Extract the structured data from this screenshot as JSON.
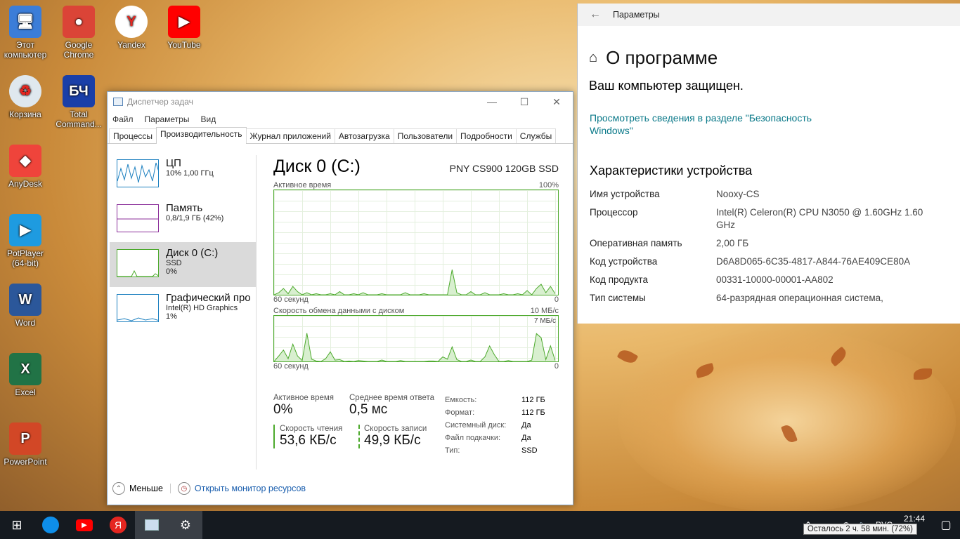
{
  "desktop": {
    "icons": [
      {
        "label": "Этот компьютер",
        "glyph": "🖥",
        "color": "#3b7dd8"
      },
      {
        "label": "Google Chrome",
        "glyph": "●",
        "color": "#db4437"
      },
      {
        "label": "Yandex",
        "glyph": "Y",
        "color": "#ffffff"
      },
      {
        "label": "YouTube",
        "glyph": "▶",
        "color": "#ff0000"
      },
      {
        "label": "Корзина",
        "glyph": "♻",
        "color": "#dfe8ee"
      },
      {
        "label": "Total Command...",
        "glyph": "БЧ",
        "color": "#1a3fa8"
      },
      {
        "label": "AnyDesk",
        "glyph": "◆",
        "color": "#ef443b"
      },
      {
        "label": "PotPlayer (64-bit)",
        "glyph": "▶",
        "color": "#1e9be0"
      },
      {
        "label": "Word",
        "glyph": "W",
        "color": "#2b579a"
      },
      {
        "label": "Excel",
        "glyph": "X",
        "color": "#217346"
      },
      {
        "label": "PowerPoint",
        "glyph": "P",
        "color": "#d24726"
      }
    ]
  },
  "taskmgr": {
    "title": "Диспетчер задач",
    "menu": [
      "Файл",
      "Параметры",
      "Вид"
    ],
    "tabs": [
      "Процессы",
      "Производительность",
      "Журнал приложений",
      "Автозагрузка",
      "Пользователи",
      "Подробности",
      "Службы"
    ],
    "side": [
      {
        "name": "ЦП",
        "s1": "10% 1,00 ГГц",
        "s2": "",
        "color": "#1b7fbf"
      },
      {
        "name": "Память",
        "s1": "0,8/1,9 ГБ (42%)",
        "s2": "",
        "color": "#8b2f9a"
      },
      {
        "name": "Диск 0 (C:)",
        "s1": "SSD",
        "s2": "0%",
        "color": "#4ca92c"
      },
      {
        "name": "Графический про",
        "s1": "Intel(R) HD Graphics",
        "s2": "1%",
        "color": "#1b7fbf"
      }
    ],
    "main": {
      "title": "Диск 0 (C:)",
      "model": "PNY CS900 120GB SSD",
      "g1_label": "Активное время",
      "g1_max": "100%",
      "g1_xleft": "60 секунд",
      "g1_xright": "0",
      "g2_label": "Скорость обмена данными с диском",
      "g2_max": "10 МБ/с",
      "g2_mark": "7 МБ/с",
      "g2_xleft": "60 секунд",
      "g2_xright": "0",
      "active_label": "Активное время",
      "active_val": "0%",
      "resp_label": "Среднее время ответа",
      "resp_val": "0,5 мс",
      "read_label": "Скорость чтения",
      "read_val": "53,6 КБ/с",
      "write_label": "Скорость записи",
      "write_val": "49,9 КБ/с",
      "props": [
        [
          "Емкость:",
          "112 ГБ"
        ],
        [
          "Формат:",
          "112 ГБ"
        ],
        [
          "Системный диск:",
          "Да"
        ],
        [
          "Файл подкачки:",
          "Да"
        ],
        [
          "Тип:",
          "SSD"
        ]
      ]
    },
    "footer": {
      "less": "Меньше",
      "monitor": "Открыть монитор ресурсов"
    }
  },
  "chart_data": [
    {
      "type": "area",
      "title": "Активное время",
      "ylim": [
        0,
        100
      ],
      "x": [
        0,
        1,
        2,
        3,
        4,
        5,
        6,
        7,
        8,
        9,
        10,
        11,
        12,
        13,
        14,
        15,
        16,
        17,
        18,
        19,
        20,
        21,
        22,
        23,
        24,
        25,
        26,
        27,
        28,
        29,
        30,
        31,
        32,
        33,
        34,
        35,
        36,
        37,
        38,
        39,
        40,
        41,
        42,
        43,
        44,
        45,
        46,
        47,
        48,
        49,
        50,
        51,
        52,
        53,
        54,
        55,
        56,
        57,
        58,
        59,
        60
      ],
      "values": [
        0,
        2,
        6,
        1,
        8,
        3,
        0,
        2,
        0,
        1,
        0,
        0,
        1,
        0,
        3,
        0,
        0,
        1,
        0,
        2,
        0,
        0,
        0,
        1,
        0,
        0,
        0,
        0,
        2,
        0,
        0,
        0,
        1,
        0,
        0,
        0,
        0,
        0,
        24,
        2,
        0,
        0,
        3,
        0,
        0,
        2,
        0,
        0,
        0,
        1,
        0,
        0,
        1,
        0,
        4,
        0,
        6,
        10,
        2,
        8,
        1
      ]
    },
    {
      "type": "area",
      "title": "Скорость обмена данными с диском",
      "ylim": [
        0,
        10
      ],
      "x": [
        0,
        1,
        2,
        3,
        4,
        5,
        6,
        7,
        8,
        9,
        10,
        11,
        12,
        13,
        14,
        15,
        16,
        17,
        18,
        19,
        20,
        21,
        22,
        23,
        24,
        25,
        26,
        27,
        28,
        29,
        30,
        31,
        32,
        33,
        34,
        35,
        36,
        37,
        38,
        39,
        40,
        41,
        42,
        43,
        44,
        45,
        46,
        47,
        48,
        49,
        50,
        51,
        52,
        53,
        54,
        55,
        56,
        57,
        58,
        59,
        60
      ],
      "values": [
        0,
        1.2,
        2.5,
        0.6,
        3.8,
        1.2,
        0.2,
        6.2,
        0.5,
        0.1,
        0,
        0.6,
        2.1,
        0.3,
        0.4,
        0,
        0.1,
        0,
        0.2,
        0.1,
        0,
        0,
        0,
        0.3,
        0,
        0,
        0,
        0.2,
        0,
        0,
        0,
        0,
        0,
        0.1,
        0.1,
        0,
        1,
        0.5,
        3.2,
        0.4,
        0,
        0,
        0.3,
        0,
        0,
        1,
        3.4,
        1.5,
        0,
        0,
        0.2,
        0,
        0,
        0,
        0,
        0.3,
        6.1,
        5.2,
        0.4,
        3.4,
        0.2
      ]
    }
  ],
  "settings": {
    "topbar": "Параметры",
    "title": "О программе",
    "protected": "Ваш компьютер защищен.",
    "link": "Просмотреть сведения в разделе \"Безопасность Windows\"",
    "specs_title": "Характеристики устройства",
    "rows": [
      [
        "Имя устройства",
        "Nooxy-CS"
      ],
      [
        "Процессор",
        "Intel(R) Celeron(R) CPU  N3050  @ 1.60GHz 1.60 GHz"
      ],
      [
        "Оперативная память",
        "2,00 ГБ"
      ],
      [
        "Код устройства",
        "D6A8D065-6C35-4817-A844-76AE409CE80A"
      ],
      [
        "Код продукта",
        "00331-10000-00001-AA802"
      ],
      [
        "Тип системы",
        "64-разрядная операционная система,"
      ]
    ]
  },
  "taskbar": {
    "lang": "РУС",
    "time": "21:44",
    "tooltip": "Осталось 2 ч. 58 мин. (72%)"
  }
}
